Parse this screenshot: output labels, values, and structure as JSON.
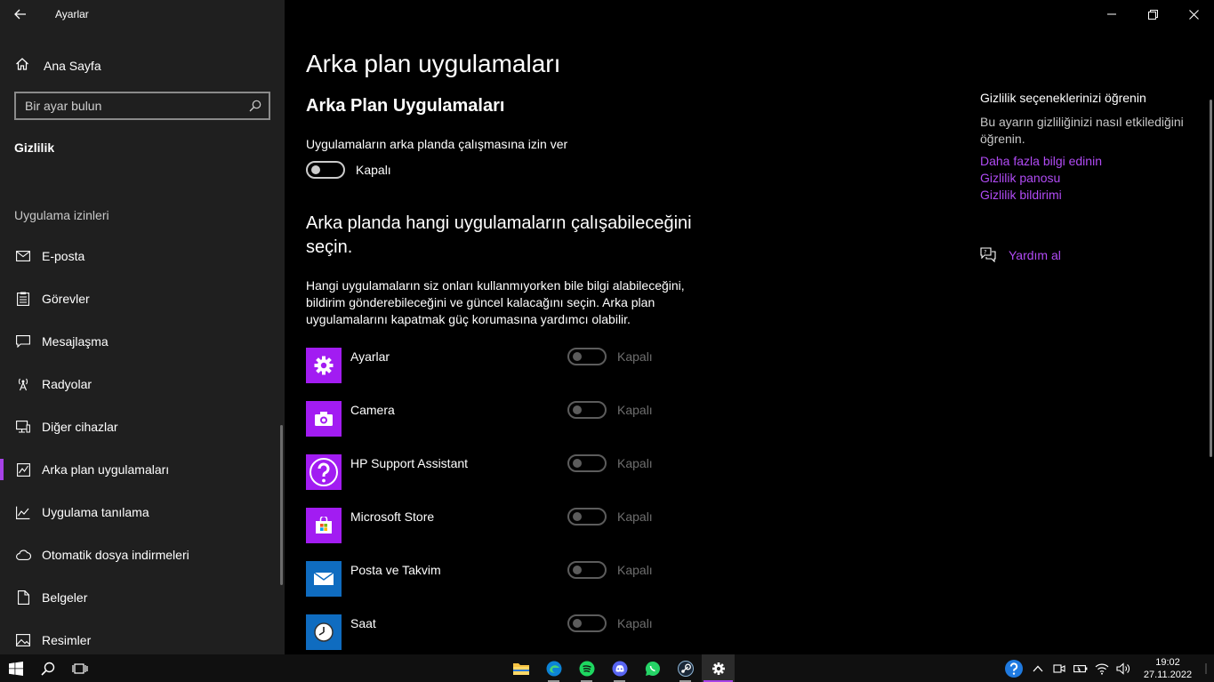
{
  "window": {
    "title": "Ayarlar"
  },
  "sidebar": {
    "home_label": "Ana Sayfa",
    "search_placeholder": "Bir ayar bulun",
    "section_title": "Gizlilik",
    "group_title": "Uygulama izinleri",
    "items": [
      {
        "label": "E-posta",
        "icon": "mail-icon"
      },
      {
        "label": "Görevler",
        "icon": "tasks-icon"
      },
      {
        "label": "Mesajlaşma",
        "icon": "chat-icon"
      },
      {
        "label": "Radyolar",
        "icon": "radio-icon"
      },
      {
        "label": "Diğer cihazlar",
        "icon": "devices-icon"
      },
      {
        "label": "Arka plan uygulamaları",
        "icon": "background-apps-icon",
        "selected": true
      },
      {
        "label": "Uygulama tanılama",
        "icon": "diagnostics-icon"
      },
      {
        "label": "Otomatik dosya indirmeleri",
        "icon": "cloud-icon"
      },
      {
        "label": "Belgeler",
        "icon": "document-icon"
      },
      {
        "label": "Resimler",
        "icon": "pictures-icon"
      }
    ]
  },
  "main": {
    "page_title": "Arka plan uygulamaları",
    "sub_title": "Arka Plan Uygulamaları",
    "allow_label": "Uygulamaların arka planda çalışmasına izin ver",
    "allow_state": "Kapalı",
    "choose_title": "Arka planda hangi uygulamaların çalışabileceğini seçin.",
    "choose_desc": "Hangi uygulamaların siz onları kullanmıyorken bile bilgi alabileceğini, bildirim gönderebileceğini ve güncel kalacağını seçin. Arka plan uygulamalarını kapatmak güç korumasına yardımcı olabilir.",
    "apps": [
      {
        "name": "Ayarlar",
        "state": "Kapalı",
        "icon": "gear-icon",
        "color": "#a21cf2"
      },
      {
        "name": "Camera",
        "state": "Kapalı",
        "icon": "camera-icon",
        "color": "#a21cf2"
      },
      {
        "name": "HP Support Assistant",
        "state": "Kapalı",
        "icon": "question-icon",
        "color": "#a21cf2"
      },
      {
        "name": "Microsoft Store",
        "state": "Kapalı",
        "icon": "store-icon",
        "color": "#a21cf2"
      },
      {
        "name": "Posta ve Takvim",
        "state": "Kapalı",
        "icon": "envelope-icon",
        "color": "#0f6cc0"
      },
      {
        "name": "Saat",
        "state": "Kapalı",
        "icon": "clock-icon",
        "color": "#0f6cc0"
      }
    ]
  },
  "aside": {
    "title": "Gizlilik seçeneklerinizi öğrenin",
    "desc": "Bu ayarın gizliliğinizi nasıl etkilediğini öğrenin.",
    "links": [
      "Daha fazla bilgi edinin",
      "Gizlilik panosu",
      "Gizlilik bildirimi"
    ],
    "help_label": "Yardım al",
    "link_color": "#b14bf5"
  },
  "taskbar": {
    "time": "19:02",
    "date": "27.11.2022",
    "accent": "#a742e8"
  }
}
